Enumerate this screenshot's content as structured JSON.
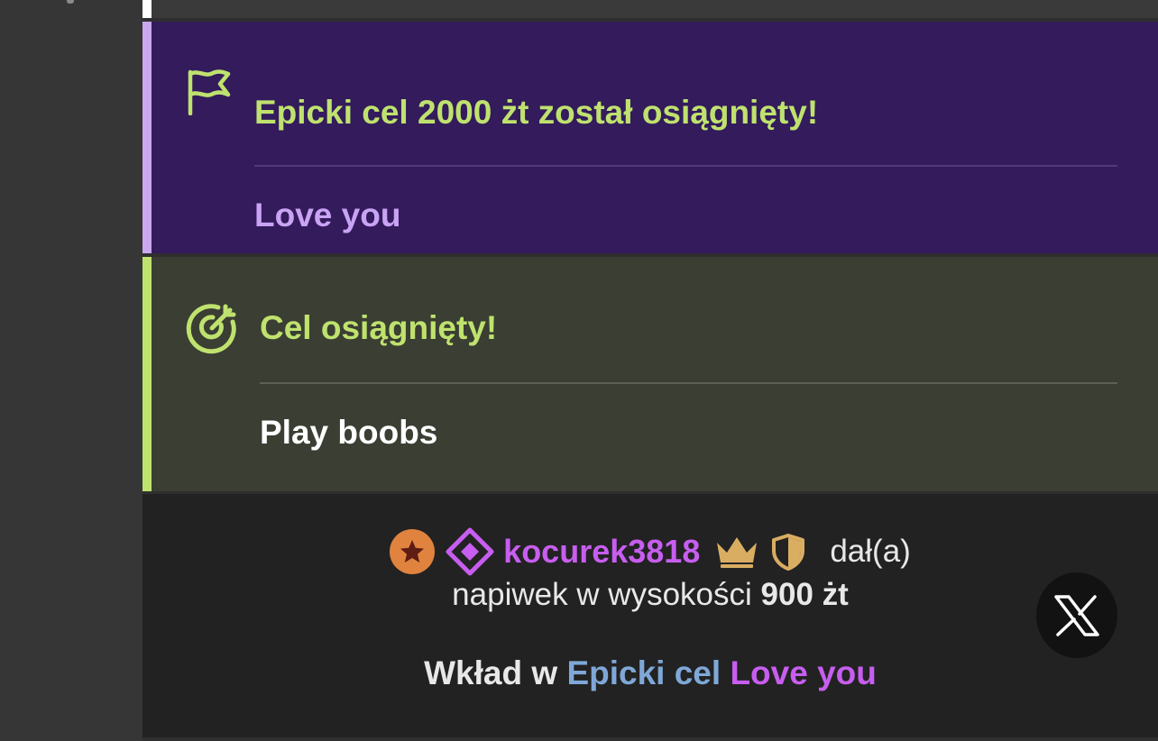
{
  "epic_goal_card": {
    "title": "Epicki cel 2000 żt został osiągnięty!",
    "message": "Love you",
    "icon": "flag-icon"
  },
  "goal_card": {
    "title": "Cel osiągnięty!",
    "message": "Play boobs",
    "icon": "target-icon"
  },
  "tip": {
    "username": "kocurek3818",
    "gave": "dał(a)",
    "amount_prefix": "napiwek w wysokości",
    "amount": "900 żt",
    "contribution_prefix": "Wkład w",
    "goal_kind": "Epicki cel",
    "goal_name": "Love you",
    "badges": [
      "star-badge-icon",
      "diamond-icon",
      "crown-icon",
      "shield-icon"
    ]
  },
  "share_button": {
    "icon": "x-logo-icon"
  },
  "colors": {
    "accent_green": "#bfe26e",
    "accent_purple": "#c75ef0",
    "epic_bg": "#331b5c",
    "goal_bg": "#3a3e33",
    "goal_kind_blue": "#7fa8d8",
    "badge_orange": "#e0833e",
    "badge_gold": "#d9ad62"
  }
}
